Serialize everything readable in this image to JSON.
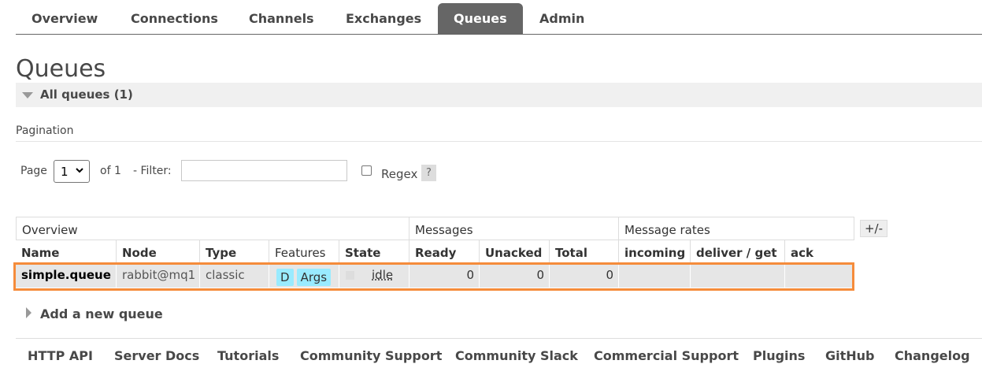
{
  "nav": {
    "tabs": [
      {
        "label": "Overview"
      },
      {
        "label": "Connections"
      },
      {
        "label": "Channels"
      },
      {
        "label": "Exchanges"
      },
      {
        "label": "Queues",
        "active": true
      },
      {
        "label": "Admin"
      }
    ]
  },
  "page": {
    "title": "Queues",
    "section": "All queues (1)"
  },
  "pagination": {
    "heading": "Pagination",
    "page_label": "Page",
    "page_value": "1",
    "of_label": "of 1",
    "filter_label": "- Filter:",
    "filter_value": "",
    "regex_label": "Regex",
    "help_label": "?"
  },
  "table": {
    "groups": [
      "Overview",
      "Messages",
      "Message rates"
    ],
    "toggle_label": "+/-",
    "headers": [
      "Name",
      "Node",
      "Type",
      "Features",
      "State",
      "Ready",
      "Unacked",
      "Total",
      "incoming",
      "deliver / get",
      "ack"
    ],
    "rows": [
      {
        "name": "simple.queue",
        "node": "rabbit@mq1",
        "type": "classic",
        "features": [
          "D",
          "Args"
        ],
        "state": "idle",
        "ready": "0",
        "unacked": "0",
        "total": "0",
        "incoming": "",
        "deliver_get": "",
        "ack": ""
      }
    ]
  },
  "add_queue": {
    "label": "Add a new queue"
  },
  "footer": {
    "links": [
      "HTTP API",
      "Server Docs",
      "Tutorials",
      "Community Support",
      "Community Slack",
      "Commercial Support",
      "Plugins",
      "GitHub",
      "Changelog"
    ]
  },
  "colors": {
    "active_tab": "#666666",
    "feature_badge": "#99ebff",
    "highlight": "#f58c3b"
  }
}
